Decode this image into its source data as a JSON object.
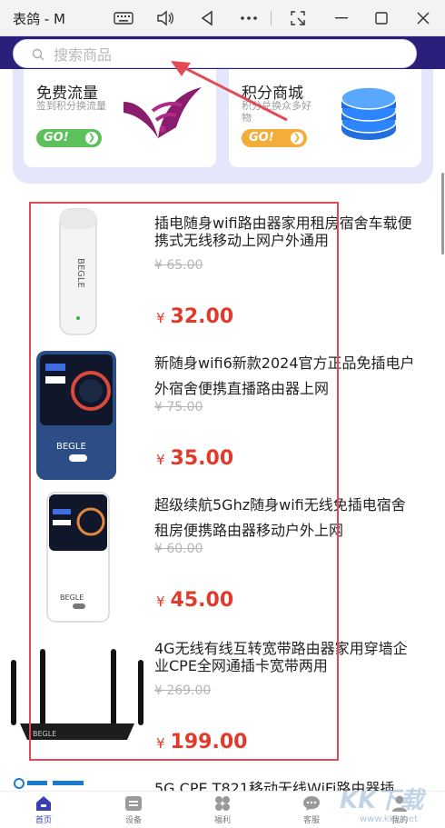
{
  "window": {
    "title": "表鸽 - M",
    "controls": [
      "keyboard-icon",
      "volume-icon",
      "back-icon",
      "more-icon",
      "screenshot-icon",
      "minimize-icon",
      "maximize-icon",
      "close-icon"
    ]
  },
  "search": {
    "placeholder": "搜索商品"
  },
  "promos": [
    {
      "title": "免费流量",
      "subtitle": "签到积分换流量",
      "go": "GO!",
      "accent": "#5cc05c"
    },
    {
      "title": "积分商城",
      "subtitle": "积分兑换众多好物",
      "go": "GO!",
      "accent": "#f2ad3a"
    }
  ],
  "products": [
    {
      "name": "插电随身wifi路由器家用租房宿舍车载便携式无线移动上网户外通用",
      "original_price": "¥ 65.00",
      "currency": "¥",
      "price": "32.00"
    },
    {
      "name": "新随身wifi6新款2024官方正品免插电户外宿舍便携直播路由器上网",
      "original_price": "¥ 75.00",
      "currency": "¥",
      "price": "35.00"
    },
    {
      "name": "超级续航5Ghz随身wifi无线免插电宿舍租房便携路由器移动户外上网",
      "original_price": "¥ 60.00",
      "currency": "¥",
      "price": "45.00"
    },
    {
      "name": "4G无线有线互转宽带路由器家用穿墙企业CPE全网通插卡宽带两用",
      "original_price": "¥ 269.00",
      "currency": "¥",
      "price": "199.00"
    }
  ],
  "next_product": {
    "name": "5G CPE T821移动无线WiFi路由器插"
  },
  "tabs": [
    {
      "label": "首页",
      "icon": "home-icon",
      "active": true
    },
    {
      "label": "设备",
      "icon": "device-icon",
      "active": false
    },
    {
      "label": "福利",
      "icon": "gift-icon",
      "active": false
    },
    {
      "label": "客服",
      "icon": "chat-icon",
      "active": false
    },
    {
      "label": "我的",
      "icon": "user-icon",
      "active": false
    }
  ],
  "watermark": {
    "big": "KK下载",
    "small": "www.kkx.net"
  },
  "colors": {
    "header": "#2a1f7a",
    "price": "#e03a2a",
    "highlight": "#e44a55",
    "promo_bg": "#e4e6fb"
  }
}
